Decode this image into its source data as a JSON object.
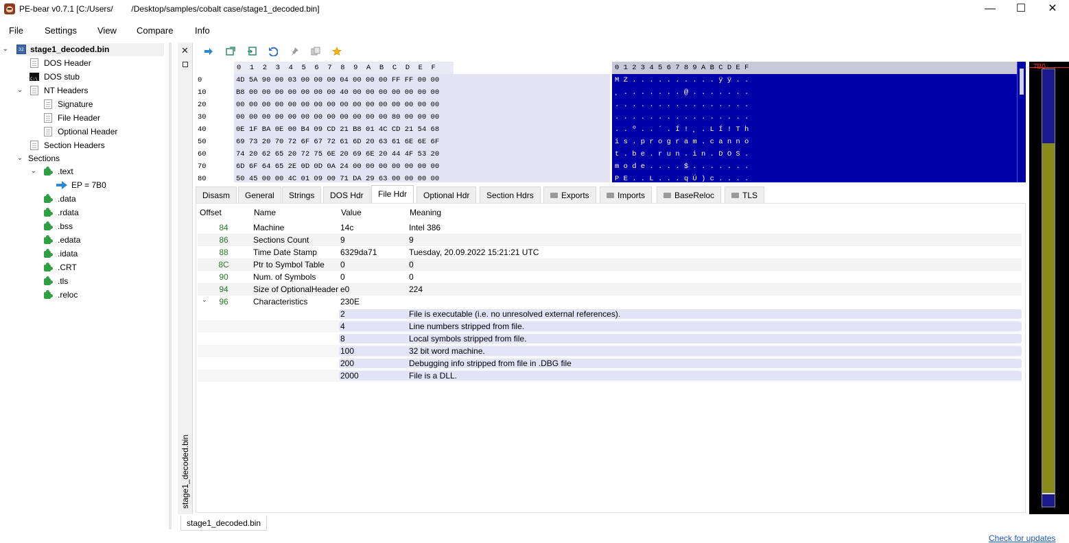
{
  "window": {
    "title": "PE-bear v0.7.1 [C:/Users/        /Desktop/samples/cobalt case/stage1_decoded.bin]",
    "minimize": "—",
    "maximize": "☐",
    "close": "✕"
  },
  "menu": [
    "File",
    "Settings",
    "View",
    "Compare",
    "Info"
  ],
  "tree": {
    "root": "stage1_decoded.bin",
    "dos_header": "DOS Header",
    "dos_stub": "DOS stub",
    "nt_headers": "NT Headers",
    "signature": "Signature",
    "file_header": "File Header",
    "optional_header": "Optional Header",
    "section_headers": "Section Headers",
    "sections": "Sections",
    "text": ".text",
    "ep": "EP = 7B0",
    "data": ".data",
    "rdata": ".rdata",
    "bss": ".bss",
    "edata": ".edata",
    "idata": ".idata",
    "crt": ".CRT",
    "tls": ".tls",
    "reloc": ".reloc"
  },
  "vertical_tab": "stage1_decoded.bin",
  "hex": {
    "header": [
      "0",
      "1",
      "2",
      "3",
      "4",
      "5",
      "6",
      "7",
      "8",
      "9",
      "A",
      "B",
      "C",
      "D",
      "E",
      "F"
    ],
    "offsets": [
      "0",
      "10",
      "20",
      "30",
      "40",
      "50",
      "60",
      "70",
      "80"
    ],
    "rows": [
      "4D 5A 90 00 03 00 00 00 04 00 00 00 FF FF 00 00",
      "B8 00 00 00 00 00 00 00 40 00 00 00 00 00 00 00",
      "00 00 00 00 00 00 00 00 00 00 00 00 00 00 00 00",
      "00 00 00 00 00 00 00 00 00 00 00 00 80 00 00 00",
      "0E 1F BA 0E 00 B4 09 CD 21 B8 01 4C CD 21 54 68",
      "69 73 20 70 72 6F 67 72 61 6D 20 63 61 6E 6E 6F",
      "74 20 62 65 20 72 75 6E 20 69 6E 20 44 4F 53 20",
      "6D 6F 64 65 2E 0D 0D 0A 24 00 00 00 00 00 00 00",
      "50 45 00 00 4C 01 09 00 71 DA 29 63 00 00 00 00"
    ]
  },
  "ascii": {
    "header": "0 1 2 3 4 5 6 7 8 9 A B C D E F",
    "rows": [
      "M Z . . . . . . . . . . ÿ ÿ . .",
      "¸ . . . . . . . @ . . . . . . .",
      ". . . . . . . . . . . . . . . .",
      ". . . . . . . . . . . . . . . .",
      ". . º . . ´ . Í ! ¸ . L Í ! T h",
      "i s . p r o g r a m . c a n n o",
      "t . b e . r u n . i n . D O S .",
      "m o d e . . . . $ . . . . . . .",
      "P E . . L . . . q Ú ) c . . . ."
    ]
  },
  "overview": {
    "label": "7B0"
  },
  "tabs": [
    "Disasm",
    "General",
    "Strings",
    "DOS Hdr",
    "File Hdr",
    "Optional Hdr",
    "Section Hdrs",
    "Exports",
    "Imports",
    "BaseReloc",
    "TLS"
  ],
  "table": {
    "headers": {
      "offset": "Offset",
      "name": "Name",
      "value": "Value",
      "meaning": "Meaning"
    },
    "rows": [
      {
        "offset": "84",
        "name": "Machine",
        "value": "14c",
        "meaning": "Intel 386"
      },
      {
        "offset": "86",
        "name": "Sections Count",
        "value": "9",
        "meaning": "9"
      },
      {
        "offset": "88",
        "name": "Time Date Stamp",
        "value": "6329da71",
        "meaning": "Tuesday, 20.09.2022 15:21:21 UTC"
      },
      {
        "offset": "8C",
        "name": "Ptr to Symbol Table",
        "value": "0",
        "meaning": "0"
      },
      {
        "offset": "90",
        "name": "Num. of Symbols",
        "value": "0",
        "meaning": "0"
      },
      {
        "offset": "94",
        "name": "Size of OptionalHeader",
        "value": "e0",
        "meaning": "224"
      },
      {
        "offset": "96",
        "name": "Characteristics",
        "value": "230E",
        "meaning": ""
      }
    ],
    "characteristics": [
      {
        "value": "2",
        "meaning": "File is executable  (i.e. no unresolved external references)."
      },
      {
        "value": "4",
        "meaning": "Line numbers stripped from file."
      },
      {
        "value": "8",
        "meaning": "Local symbols stripped from file."
      },
      {
        "value": "100",
        "meaning": "32 bit word machine."
      },
      {
        "value": "200",
        "meaning": "Debugging info stripped from file in .DBG file"
      },
      {
        "value": "2000",
        "meaning": "File is a DLL."
      }
    ]
  },
  "bottom_tab": "stage1_decoded.bin",
  "check_updates": "Check for updates",
  "colors": {
    "ascii_bg": "#0000a8",
    "offset_green": "#2a7a2a",
    "link": "#1a56c4"
  }
}
